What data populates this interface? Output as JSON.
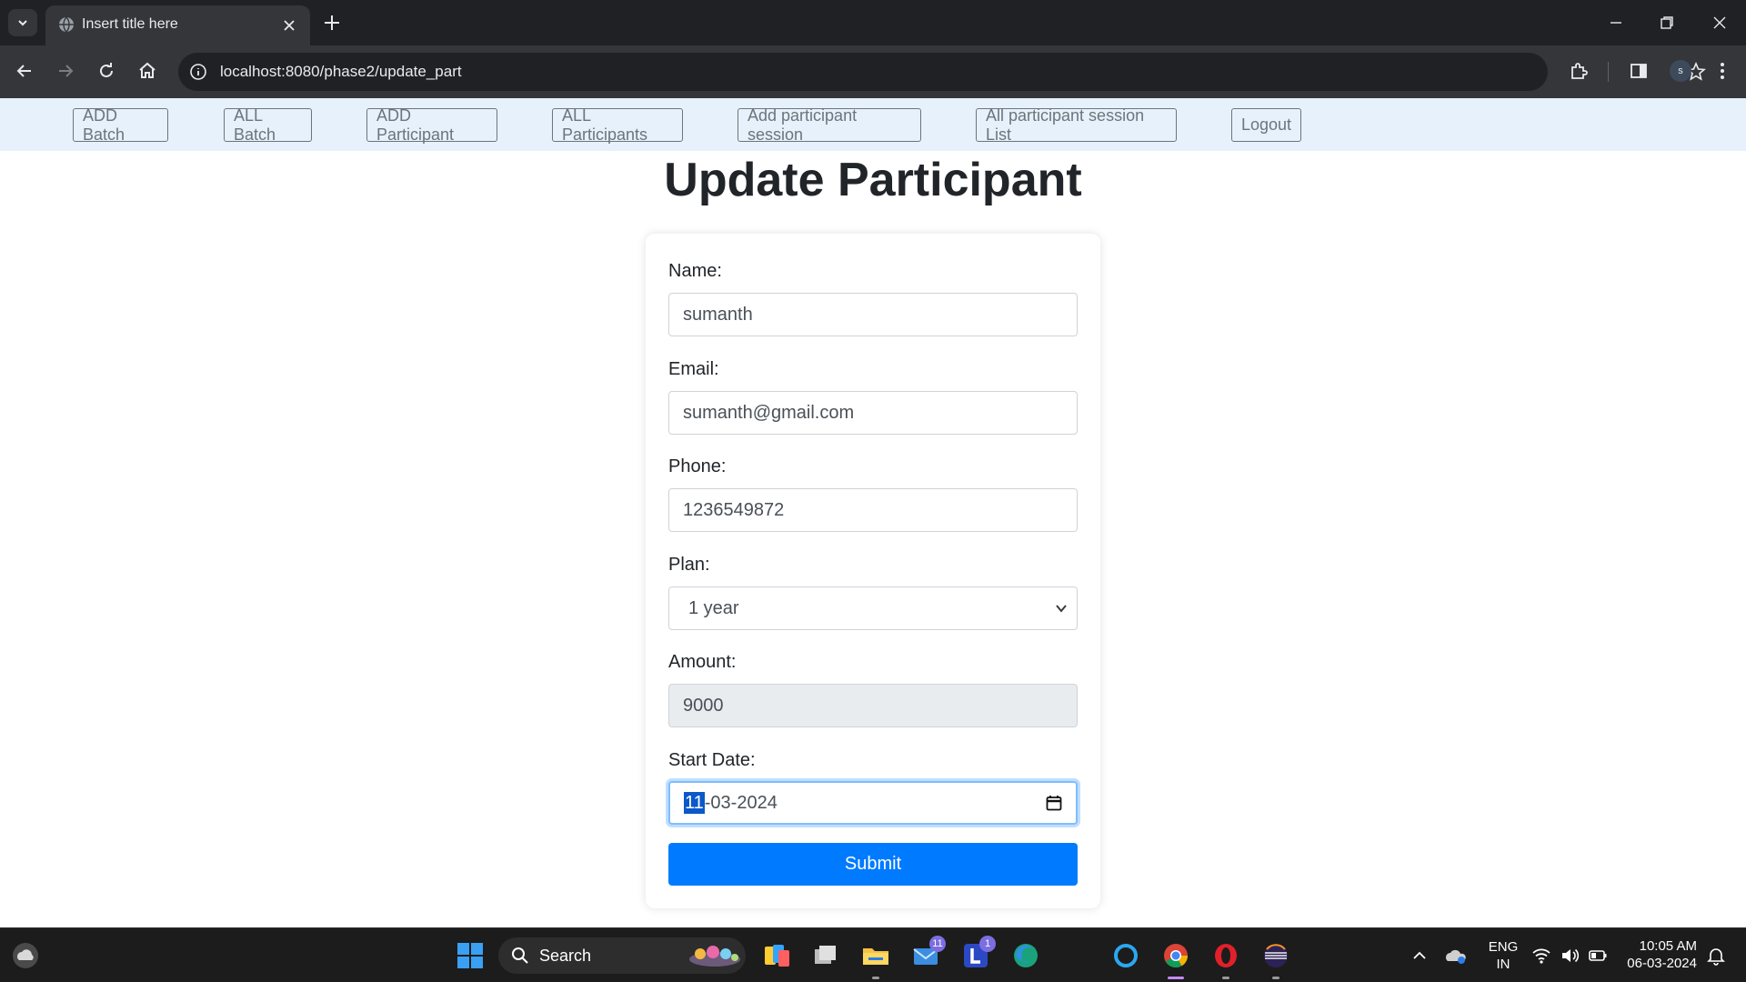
{
  "browser": {
    "tab_title": "Insert title here",
    "url": "localhost:8080/phase2/update_part",
    "profile_initial": "s"
  },
  "nav": {
    "links": [
      "ADD Batch",
      "ALL Batch",
      "ADD Participant",
      "ALL Participants",
      "Add participant session",
      "All participant session List",
      "Logout"
    ]
  },
  "page": {
    "title": "Update Participant"
  },
  "form": {
    "name_label": "Name:",
    "name_value": "sumanth",
    "email_label": "Email:",
    "email_value": "sumanth@gmail.com",
    "phone_label": "Phone:",
    "phone_value": "1236549872",
    "plan_label": "Plan:",
    "plan_value": "1 year",
    "amount_label": "Amount:",
    "amount_value": "9000",
    "start_date_label": "Start Date:",
    "start_date_day": "11",
    "start_date_rest": "-03-2024",
    "submit_label": "Submit"
  },
  "taskbar": {
    "search_text": "Search",
    "mail_badge": "11",
    "l_badge": "1",
    "lang_line1": "ENG",
    "lang_line2": "IN",
    "time": "10:05 AM",
    "date": "06-03-2024"
  },
  "colors": {
    "primary": "#007bff",
    "navbar_bg": "#e6f1fb",
    "chrome_dark": "#202124"
  }
}
